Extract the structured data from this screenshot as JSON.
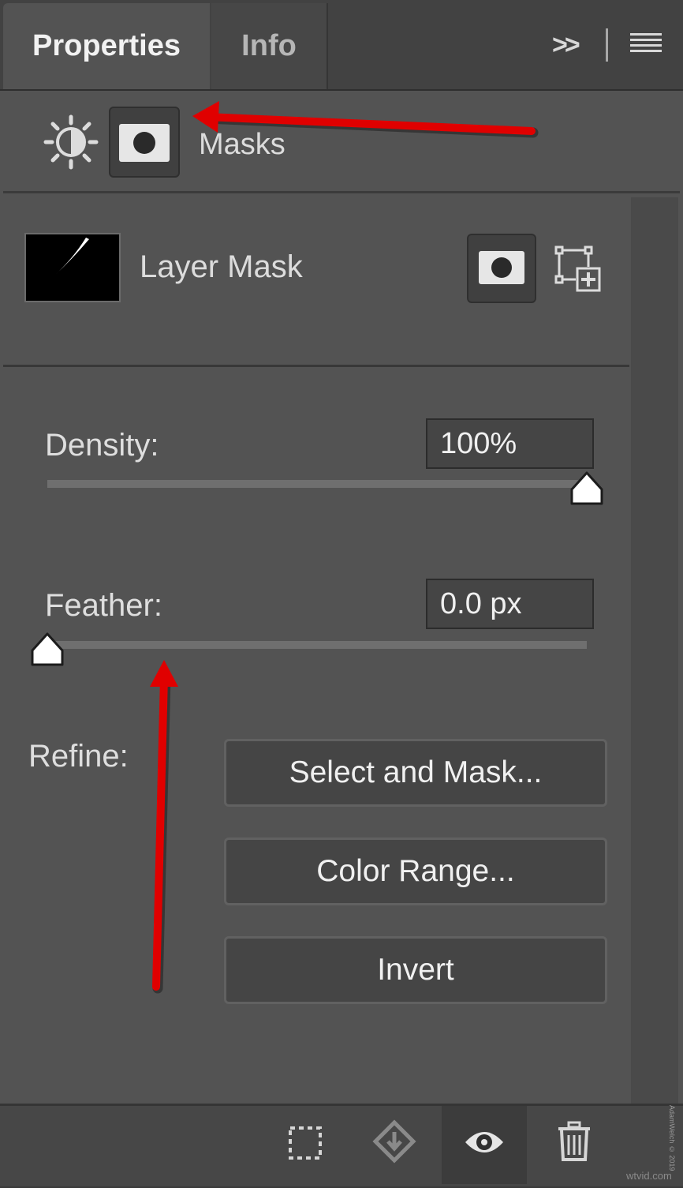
{
  "tabs": {
    "properties": "Properties",
    "info": "Info",
    "collapse_glyph": ">>"
  },
  "header": {
    "mode_label": "Masks"
  },
  "mask": {
    "title": "Layer Mask"
  },
  "density": {
    "label": "Density:",
    "value": "100%",
    "slider_fraction": 1.0
  },
  "feather": {
    "label": "Feather:",
    "value": "0.0 px",
    "slider_fraction": 0.0
  },
  "refine": {
    "label": "Refine:",
    "buttons": [
      "Select and Mask...",
      "Color Range...",
      "Invert"
    ]
  },
  "footer": {
    "icons": [
      "selection-icon",
      "apply-mask-icon",
      "eye-icon",
      "trash-icon"
    ]
  },
  "watermark": "AdamWelch © 2019",
  "site": "wtvid.com",
  "colors": {
    "panel": "#535353",
    "annotation_arrow": "#e00000"
  }
}
